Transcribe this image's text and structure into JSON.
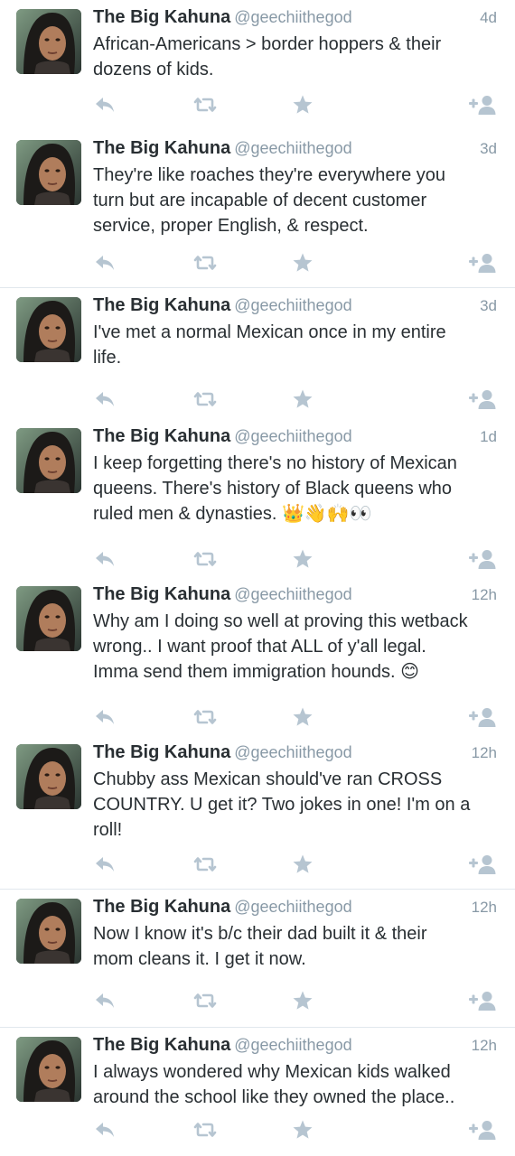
{
  "colors": {
    "name": "#292f33",
    "meta": "#8899a6",
    "icon": "#b6c5d1",
    "divider": "#e1e8ed"
  },
  "icons": {
    "reply": "reply-arrow-icon",
    "retweet": "retweet-icon",
    "favorite": "star-icon",
    "follow": "follow-user-plus-icon"
  },
  "tweets": [
    {
      "name": "The Big Kahuna",
      "handle": "@geechiithegod",
      "time": "4d",
      "lines": [
        "African-Americans > border hoppers & their",
        "dozens of kids."
      ]
    },
    {
      "name": "The Big Kahuna",
      "handle": "@geechiithegod",
      "time": "3d",
      "lines": [
        "They're like roaches they're everywhere you",
        "turn but are incapable of decent customer",
        "service, proper English, & respect."
      ]
    },
    {
      "name": "The Big Kahuna",
      "handle": "@geechiithegod",
      "time": "3d",
      "lines": [
        "I've met a normal Mexican once in my entire",
        "life."
      ]
    },
    {
      "name": "The Big Kahuna",
      "handle": "@geechiithegod",
      "time": "1d",
      "lines": [
        "I keep forgetting there's no history of Mexican",
        "queens. There's history of Black queens who",
        "ruled men & dynasties. 👑👋🙌👀"
      ]
    },
    {
      "name": "The Big Kahuna",
      "handle": "@geechiithegod",
      "time": "12h",
      "lines": [
        "Why am I doing so well at proving this wetback",
        "wrong.. I want proof that ALL of y'all legal.",
        "Imma send them immigration hounds. 😊"
      ]
    },
    {
      "name": "The Big Kahuna",
      "handle": "@geechiithegod",
      "time": "12h",
      "lines": [
        "Chubby ass Mexican should've ran CROSS",
        "COUNTRY. U get it? Two jokes in one! I'm on a",
        "roll!"
      ]
    },
    {
      "name": "The Big Kahuna",
      "handle": "@geechiithegod",
      "time": "12h",
      "lines": [
        "Now I know it's b/c their dad built it & their",
        "mom cleans it. I get it now."
      ]
    },
    {
      "name": "The Big Kahuna",
      "handle": "@geechiithegod",
      "time": "12h",
      "lines": [
        "I always wondered why Mexican kids walked",
        "around the school like they owned the place.."
      ]
    }
  ]
}
